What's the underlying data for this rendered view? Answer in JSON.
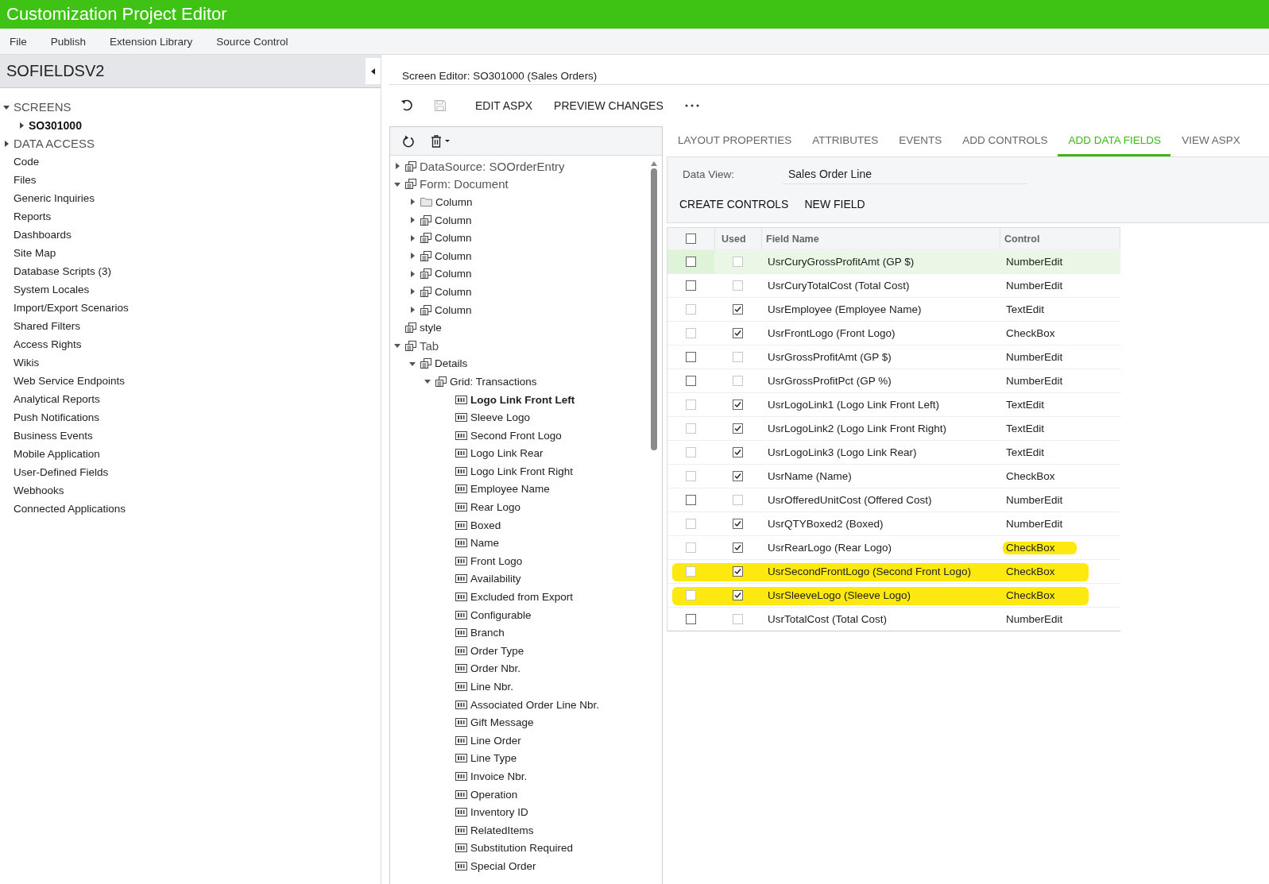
{
  "window": {
    "title": "Customization Project Editor"
  },
  "menu": [
    "File",
    "Publish",
    "Extension Library",
    "Source Control"
  ],
  "project": {
    "name": "SOFIELDSV2"
  },
  "sidebar": [
    {
      "label": "SCREENS",
      "kind": "section",
      "expanded": true,
      "selected": false,
      "children": [
        {
          "label": "SO301000",
          "kind": "screen",
          "expanded": false,
          "selected": true
        }
      ]
    },
    {
      "label": "DATA ACCESS",
      "kind": "section",
      "expanded": false,
      "selected": false
    },
    {
      "label": "Code",
      "kind": "item",
      "selected": false
    },
    {
      "label": "Files",
      "kind": "item",
      "selected": false
    },
    {
      "label": "Generic Inquiries",
      "kind": "item",
      "selected": false
    },
    {
      "label": "Reports",
      "kind": "item",
      "selected": false
    },
    {
      "label": "Dashboards",
      "kind": "item",
      "selected": false
    },
    {
      "label": "Site Map",
      "kind": "item",
      "selected": false
    },
    {
      "label": "Database Scripts (3)",
      "kind": "item",
      "selected": false
    },
    {
      "label": "System Locales",
      "kind": "item",
      "selected": false
    },
    {
      "label": "Import/Export Scenarios",
      "kind": "item",
      "selected": false
    },
    {
      "label": "Shared Filters",
      "kind": "item",
      "selected": false
    },
    {
      "label": "Access Rights",
      "kind": "item",
      "selected": false
    },
    {
      "label": "Wikis",
      "kind": "item",
      "selected": false
    },
    {
      "label": "Web Service Endpoints",
      "kind": "item",
      "selected": false
    },
    {
      "label": "Analytical Reports",
      "kind": "item",
      "selected": false
    },
    {
      "label": "Push Notifications",
      "kind": "item",
      "selected": false
    },
    {
      "label": "Business Events",
      "kind": "item",
      "selected": false
    },
    {
      "label": "Mobile Application",
      "kind": "item",
      "selected": false
    },
    {
      "label": "User-Defined Fields",
      "kind": "item",
      "selected": false
    },
    {
      "label": "Webhooks",
      "kind": "item",
      "selected": false
    },
    {
      "label": "Connected Applications",
      "kind": "item",
      "selected": false
    }
  ],
  "editor": {
    "title": "Screen Editor: SO301000 (Sales Orders)",
    "toolbar": [
      "EDIT ASPX",
      "PREVIEW CHANGES"
    ]
  },
  "tree": [
    {
      "label": "DataSource: SOOrderEntry",
      "kind": "container",
      "expanded": false,
      "selected": false
    },
    {
      "label": "Form: Document",
      "kind": "container",
      "expanded": true,
      "selected": false,
      "children": [
        {
          "label": "Column",
          "kind": "folder",
          "expanded": false,
          "selected": false
        },
        {
          "label": "Column",
          "kind": "container",
          "expanded": false,
          "selected": false
        },
        {
          "label": "Column",
          "kind": "container",
          "expanded": false,
          "selected": false
        },
        {
          "label": "Column",
          "kind": "container",
          "expanded": false,
          "selected": false
        },
        {
          "label": "Column",
          "kind": "container",
          "expanded": false,
          "selected": false
        },
        {
          "label": "Column",
          "kind": "container",
          "expanded": false,
          "selected": false
        },
        {
          "label": "Column",
          "kind": "container",
          "expanded": false,
          "selected": false
        }
      ]
    },
    {
      "label": "style",
      "kind": "style",
      "selected": false
    },
    {
      "label": "Tab",
      "kind": "container",
      "expanded": true,
      "selected": false,
      "children": [
        {
          "label": "Details",
          "kind": "container",
          "expanded": true,
          "selected": false,
          "children": [
            {
              "label": "Grid: Transactions",
              "kind": "container",
              "expanded": true,
              "selected": false,
              "children": [
                {
                  "label": "Logo Link Front Left",
                  "kind": "field",
                  "selected": true
                },
                {
                  "label": "Sleeve Logo",
                  "kind": "field",
                  "selected": false
                },
                {
                  "label": "Second Front Logo",
                  "kind": "field",
                  "selected": false
                },
                {
                  "label": "Logo Link Rear",
                  "kind": "field",
                  "selected": false
                },
                {
                  "label": "Logo Link Front Right",
                  "kind": "field",
                  "selected": false
                },
                {
                  "label": "Employee Name",
                  "kind": "field",
                  "selected": false
                },
                {
                  "label": "Rear Logo",
                  "kind": "field",
                  "selected": false
                },
                {
                  "label": "Boxed",
                  "kind": "field",
                  "selected": false
                },
                {
                  "label": "Name",
                  "kind": "field",
                  "selected": false
                },
                {
                  "label": "Front Logo",
                  "kind": "field",
                  "selected": false
                },
                {
                  "label": "Availability",
                  "kind": "field",
                  "selected": false
                },
                {
                  "label": "Excluded from Export",
                  "kind": "field",
                  "selected": false
                },
                {
                  "label": "Configurable",
                  "kind": "field",
                  "selected": false
                },
                {
                  "label": "Branch",
                  "kind": "field",
                  "selected": false
                },
                {
                  "label": "Order Type",
                  "kind": "field",
                  "selected": false
                },
                {
                  "label": "Order Nbr.",
                  "kind": "field",
                  "selected": false
                },
                {
                  "label": "Line Nbr.",
                  "kind": "field",
                  "selected": false
                },
                {
                  "label": "Associated Order Line Nbr.",
                  "kind": "field",
                  "selected": false
                },
                {
                  "label": "Gift Message",
                  "kind": "field",
                  "selected": false
                },
                {
                  "label": "Line Order",
                  "kind": "field",
                  "selected": false
                },
                {
                  "label": "Line Type",
                  "kind": "field",
                  "selected": false
                },
                {
                  "label": "Invoice Nbr.",
                  "kind": "field",
                  "selected": false
                },
                {
                  "label": "Operation",
                  "kind": "field",
                  "selected": false
                },
                {
                  "label": "Inventory ID",
                  "kind": "field",
                  "selected": false
                },
                {
                  "label": "RelatedItems",
                  "kind": "field",
                  "selected": false
                },
                {
                  "label": "Substitution Required",
                  "kind": "field",
                  "selected": false
                },
                {
                  "label": "Special Order",
                  "kind": "field",
                  "selected": false
                }
              ]
            }
          ]
        }
      ]
    }
  ],
  "tabs": [
    {
      "label": "LAYOUT PROPERTIES",
      "selected": false
    },
    {
      "label": "ATTRIBUTES",
      "selected": false
    },
    {
      "label": "EVENTS",
      "selected": false
    },
    {
      "label": "ADD CONTROLS",
      "selected": false
    },
    {
      "label": "ADD DATA FIELDS",
      "selected": true
    },
    {
      "label": "VIEW ASPX",
      "selected": false
    }
  ],
  "data_view": {
    "label": "Data View:",
    "value": "Sales Order Line"
  },
  "actions": [
    "CREATE CONTROLS",
    "NEW FIELD"
  ],
  "grid": {
    "columns": [
      "Used",
      "Field Name",
      "Control"
    ],
    "select_all": false,
    "rows": [
      {
        "checked": false,
        "used": false,
        "field": "UsrCuryGrossProfitAmt (GP $)",
        "control": "NumberEdit",
        "selected": true
      },
      {
        "checked": false,
        "used": false,
        "field": "UsrCuryTotalCost (Total Cost)",
        "control": "NumberEdit",
        "selected": false
      },
      {
        "checked": false,
        "used": true,
        "field": "UsrEmployee (Employee Name)",
        "control": "TextEdit",
        "selected": false
      },
      {
        "checked": false,
        "used": true,
        "field": "UsrFrontLogo (Front Logo)",
        "control": "CheckBox",
        "selected": false
      },
      {
        "checked": false,
        "used": false,
        "field": "UsrGrossProfitAmt (GP $)",
        "control": "NumberEdit",
        "selected": false
      },
      {
        "checked": false,
        "used": false,
        "field": "UsrGrossProfitPct (GP %)",
        "control": "NumberEdit",
        "selected": false
      },
      {
        "checked": false,
        "used": true,
        "field": "UsrLogoLink1 (Logo Link Front Left)",
        "control": "TextEdit",
        "selected": false
      },
      {
        "checked": false,
        "used": true,
        "field": "UsrLogoLink2 (Logo Link Front Right)",
        "control": "TextEdit",
        "selected": false
      },
      {
        "checked": false,
        "used": true,
        "field": "UsrLogoLink3 (Logo Link Rear)",
        "control": "TextEdit",
        "selected": false
      },
      {
        "checked": false,
        "used": true,
        "field": "UsrName (Name)",
        "control": "CheckBox",
        "selected": false
      },
      {
        "checked": false,
        "used": false,
        "field": "UsrOfferedUnitCost (Offered Cost)",
        "control": "NumberEdit",
        "selected": false
      },
      {
        "checked": false,
        "used": true,
        "field": "UsrQTYBoxed2 (Boxed)",
        "control": "NumberEdit",
        "selected": false
      },
      {
        "checked": false,
        "used": true,
        "field": "UsrRearLogo (Rear Logo)",
        "control": "CheckBox",
        "selected": false,
        "control_highlighted": true
      },
      {
        "checked": false,
        "used": true,
        "field": "UsrSecondFrontLogo (Second Front Logo)",
        "control": "CheckBox",
        "selected": false,
        "field_highlighted": true,
        "control_highlighted": true
      },
      {
        "checked": false,
        "used": true,
        "field": "UsrSleeveLogo (Sleeve Logo)",
        "control": "CheckBox",
        "selected": false,
        "field_highlighted": true,
        "control_highlighted": true
      },
      {
        "checked": false,
        "used": false,
        "field": "UsrTotalCost (Total Cost)",
        "control": "NumberEdit",
        "selected": false
      }
    ]
  }
}
